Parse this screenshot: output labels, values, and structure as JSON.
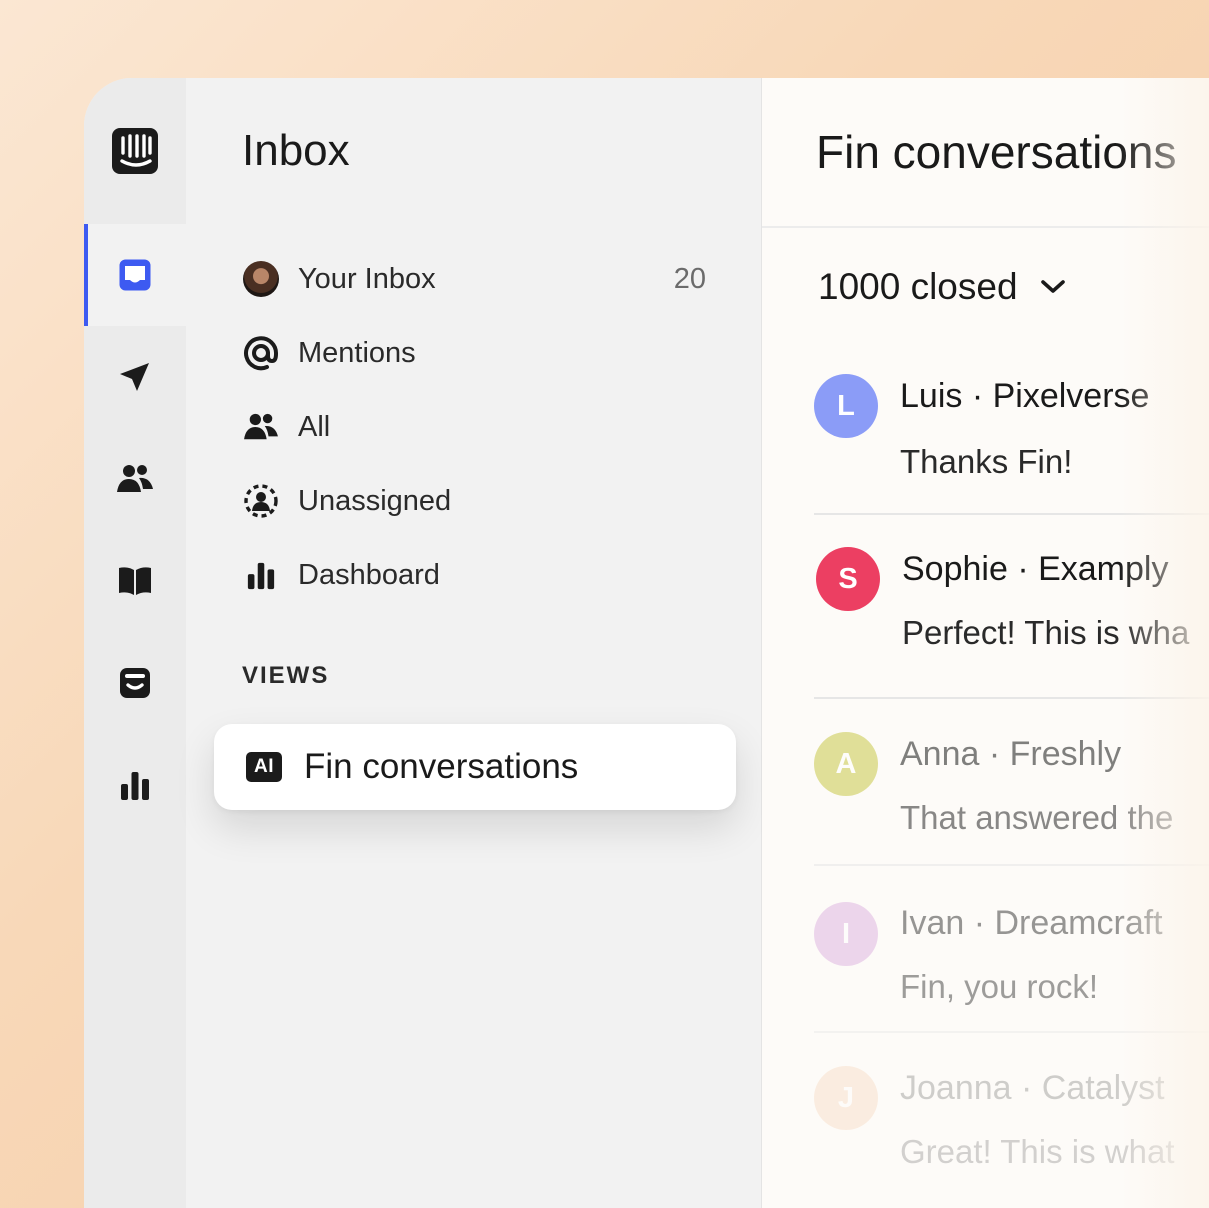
{
  "rail": {
    "items": [
      {
        "icon": "logo-icon"
      },
      {
        "icon": "inbox-icon",
        "active": true
      },
      {
        "icon": "send-icon"
      },
      {
        "icon": "contacts-icon"
      },
      {
        "icon": "book-icon"
      },
      {
        "icon": "messenger-icon"
      },
      {
        "icon": "reports-icon"
      }
    ],
    "accent": "#3d5af1"
  },
  "nav": {
    "title": "Inbox",
    "items": [
      {
        "label": "Your Inbox",
        "count": "20",
        "icon": "avatar"
      },
      {
        "label": "Mentions",
        "icon": "at-icon"
      },
      {
        "label": "All",
        "icon": "team-icon"
      },
      {
        "label": "Unassigned",
        "icon": "unassigned-icon"
      },
      {
        "label": "Dashboard",
        "icon": "bar-chart-icon"
      }
    ],
    "views_label": "VIEWS",
    "views": [
      {
        "badge": "AI",
        "label": "Fin conversations",
        "active": true
      }
    ]
  },
  "main": {
    "title": "Fin conversations",
    "filter_label": "1000 closed",
    "conversations": [
      {
        "initial": "L",
        "name": "Luis · Pixelverse",
        "message": "Thanks Fin!",
        "color": "#8b9cf7"
      },
      {
        "initial": "S",
        "name": "Sophie · Examply",
        "message": "Perfect! This is wha",
        "color": "#ec3f62"
      },
      {
        "initial": "A",
        "name": "Anna · Freshly",
        "message": "That answered the",
        "color": "#d7d77a"
      },
      {
        "initial": "I",
        "name": "Ivan · Dreamcraft",
        "message": "Fin, you rock!",
        "color": "#e3c5e6"
      },
      {
        "initial": "J",
        "name": "Joanna · Catalyst",
        "message": "Great! This is what",
        "color": "#f9ddc2"
      }
    ]
  }
}
